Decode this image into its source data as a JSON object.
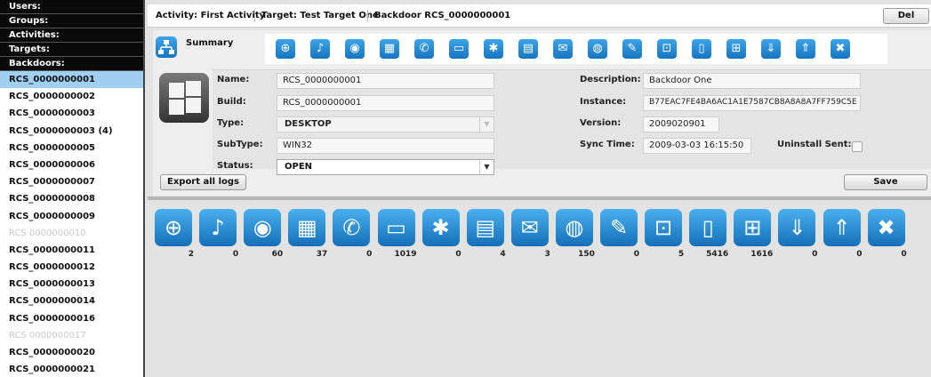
{
  "sidebar": {
    "categories": [
      "Users:",
      "Groups:",
      "Activities:",
      "Targets:",
      "Backdoors:"
    ],
    "backdoors": [
      {
        "label": "RCS_0000000001",
        "state": "selected"
      },
      {
        "label": "RCS_0000000002",
        "state": "normal"
      },
      {
        "label": "RCS_0000000003",
        "state": "normal"
      },
      {
        "label": "RCS_0000000003 (4)",
        "state": "normal"
      },
      {
        "label": "RCS_0000000005",
        "state": "normal"
      },
      {
        "label": "RCS_0000000006",
        "state": "normal"
      },
      {
        "label": "RCS_0000000007",
        "state": "normal"
      },
      {
        "label": "RCS_0000000008",
        "state": "normal"
      },
      {
        "label": "RCS_0000000009",
        "state": "normal"
      },
      {
        "label": "RCS 0000000010",
        "state": "disabled"
      },
      {
        "label": "RCS_0000000011",
        "state": "normal"
      },
      {
        "label": "RCS_0000000012",
        "state": "normal"
      },
      {
        "label": "RCS_0000000013",
        "state": "normal"
      },
      {
        "label": "RCS_0000000014",
        "state": "normal"
      },
      {
        "label": "RCS_0000000016",
        "state": "normal"
      },
      {
        "label": "RCS 0000000017",
        "state": "disabled"
      },
      {
        "label": "RCS_0000000020",
        "state": "normal"
      },
      {
        "label": "RCS_0000000021",
        "state": "normal"
      }
    ]
  },
  "breadcrumb": {
    "activity": "Activity: First Activity",
    "target": "Target: Test Target One",
    "backdoor": "Backdoor RCS_0000000001",
    "delete_label": "Del"
  },
  "summary": {
    "label": "Summary",
    "toolbar_icons": [
      "browser-icon",
      "microphone-icon",
      "webcam-icon",
      "applications-icon",
      "chat-icon",
      "screenshot-icon",
      "mouse-icon",
      "print-icon",
      "mail-icon",
      "url-icon",
      "clipboard-icon",
      "password-icon",
      "file-icon",
      "file-capture-icon",
      "download-icon",
      "upload-icon",
      "tools-icon"
    ]
  },
  "fields": {
    "name_label": "Name:",
    "name_value": "RCS_0000000001",
    "build_label": "Build:",
    "build_value": "RCS_0000000001",
    "type_label": "Type:",
    "type_value": "DESKTOP",
    "subtype_label": "SubType:",
    "subtype_value": "WIN32",
    "status_label": "Status:",
    "status_value": "OPEN",
    "description_label": "Description:",
    "description_value": "Backdoor One",
    "instance_label": "Instance:",
    "instance_value": "B77EAC7FE4BA6AC1A1E7587CB8A8A8A7FF759C5E",
    "version_label": "Version:",
    "version_value": "2009020901",
    "sync_label": "Sync Time:",
    "sync_value": "2009-03-03 16:15:50",
    "uninstall_label": "Uninstall Sent:",
    "uninstall_checked": false
  },
  "actions": {
    "export_label": "Export all logs",
    "save_label": "Save"
  },
  "logs": [
    {
      "icon": "browser-icon",
      "glyph": "⊕",
      "count": "2"
    },
    {
      "icon": "microphone-icon",
      "glyph": "♪",
      "count": "0"
    },
    {
      "icon": "webcam-icon",
      "glyph": "◉",
      "count": "60"
    },
    {
      "icon": "applications-icon",
      "glyph": "▦",
      "count": "37"
    },
    {
      "icon": "chat-icon",
      "glyph": "✆",
      "count": "0"
    },
    {
      "icon": "screenshot-icon",
      "glyph": "▭",
      "count": "1019"
    },
    {
      "icon": "mouse-icon",
      "glyph": "✱",
      "count": "0"
    },
    {
      "icon": "print-icon",
      "glyph": "▤",
      "count": "4"
    },
    {
      "icon": "mail-icon",
      "glyph": "✉",
      "count": "3"
    },
    {
      "icon": "url-icon",
      "glyph": "◍",
      "count": "150"
    },
    {
      "icon": "clipboard-icon",
      "glyph": "✎",
      "count": "0"
    },
    {
      "icon": "password-icon",
      "glyph": "⊡",
      "count": "5"
    },
    {
      "icon": "file-icon",
      "glyph": "▯",
      "count": "5416"
    },
    {
      "icon": "file-capture-icon",
      "glyph": "⊞",
      "count": "1616"
    },
    {
      "icon": "download-icon",
      "glyph": "⇓",
      "count": "0"
    },
    {
      "icon": "upload-icon",
      "glyph": "⇑",
      "count": "0"
    },
    {
      "icon": "tools-icon",
      "glyph": "✖",
      "count": "0"
    }
  ]
}
